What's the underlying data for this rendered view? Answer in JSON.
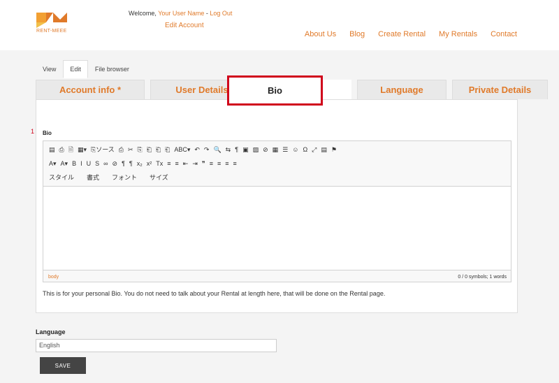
{
  "header": {
    "logo_text": "RENT-MEEE",
    "welcome_prefix": "Welcome, ",
    "user_name": "Your User Name",
    "separator": " - ",
    "logout": "Log Out",
    "edit_account": "Edit Account",
    "nav": [
      "About Us",
      "Blog",
      "Create Rental",
      "My Rentals",
      "Contact"
    ]
  },
  "subtabs": [
    "View",
    "Edit",
    "File browser"
  ],
  "tabs": [
    "Account info *",
    "User Details",
    "Bio",
    "Language",
    "Private Details"
  ],
  "annotation_marker": "1",
  "bio": {
    "label": "Bio",
    "toolbar_row1": [
      "▤",
      "⎙",
      "🗎",
      "▦▾",
      "⎘ソース",
      "⎙",
      "✂",
      "⎘",
      "⎗",
      "⎗",
      "⎗",
      "ABC▾",
      "↶",
      "↷",
      "🔍",
      "⇆",
      "¶",
      "▣",
      "▨",
      "⊘",
      "▦",
      "☰",
      "☺",
      "Ω",
      "⤢",
      "▤",
      "⚑"
    ],
    "toolbar_row2": [
      "A▾",
      "A▾",
      "B",
      "I",
      "U",
      "S",
      "∞",
      "⊘",
      "¶",
      "¶",
      "x₂",
      "x²",
      "Tx",
      "≡",
      "≡",
      "⇤",
      "⇥",
      "❞",
      "≡",
      "≡",
      "≡",
      "≡"
    ],
    "toolbar_row3": [
      "スタイル",
      "書式",
      "フォント",
      "サイズ"
    ],
    "status_path": "body",
    "status_count": "0 / 0 symbols; 1 words",
    "help": "This is for your personal Bio. You do not need to talk about your Rental at length here, that will be done on the Rental page."
  },
  "language": {
    "label": "Language",
    "value": "English"
  },
  "save_label": "SAVE",
  "colors": {
    "accent": "#e07a2a",
    "highlight": "#d0021b"
  }
}
